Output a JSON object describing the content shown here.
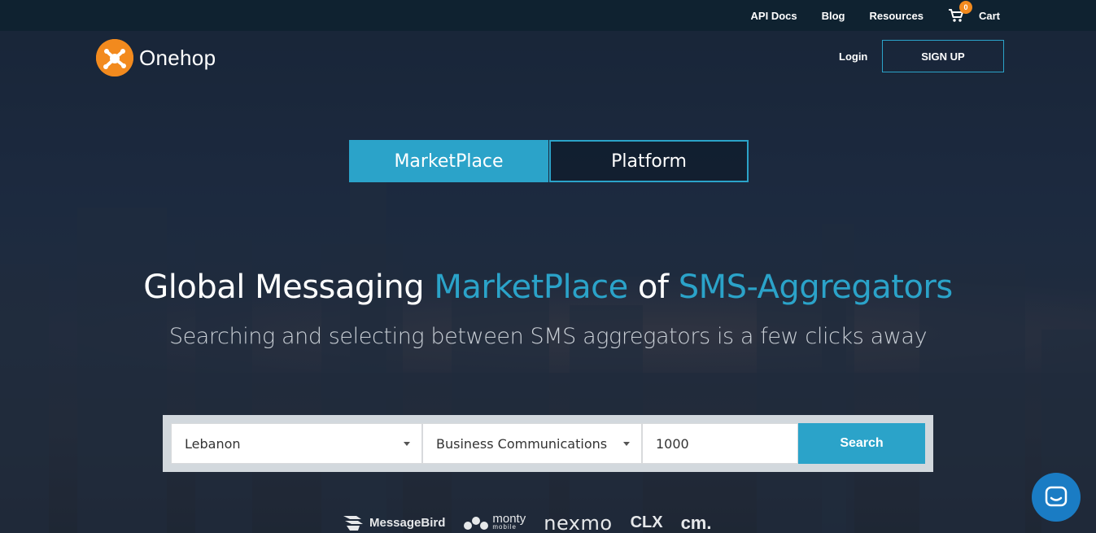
{
  "topbar": {
    "links": [
      "API Docs",
      "Blog",
      "Resources"
    ],
    "cart_label": "Cart",
    "cart_count": "0"
  },
  "header": {
    "brand": "Onehop",
    "login_label": "Login",
    "signup_label": "SIGN UP"
  },
  "tabs": [
    {
      "label": "MarketPlace",
      "active": true
    },
    {
      "label": "Platform",
      "active": false
    }
  ],
  "hero": {
    "title_part1": "Global Messaging ",
    "title_hl1": "MarketPlace",
    "title_part2": " of ",
    "title_hl2": "SMS-Aggregators",
    "subtitle": "Searching and selecting between SMS aggregators is a few clicks away"
  },
  "search": {
    "country": "Lebanon",
    "category": "Business Communications",
    "quantity": "1000",
    "button_label": "Search"
  },
  "partners": {
    "messagebird": "MessageBird",
    "monty": "monty",
    "monty_sub": "mobile",
    "nexmo": "nexmo",
    "clx": "CLX",
    "cm": "cm."
  },
  "colors": {
    "accent": "#2ba3c9",
    "brand_orange": "#f28a1e",
    "topbar_bg": "#0f2230",
    "chat_blue": "#1a7cc4"
  }
}
